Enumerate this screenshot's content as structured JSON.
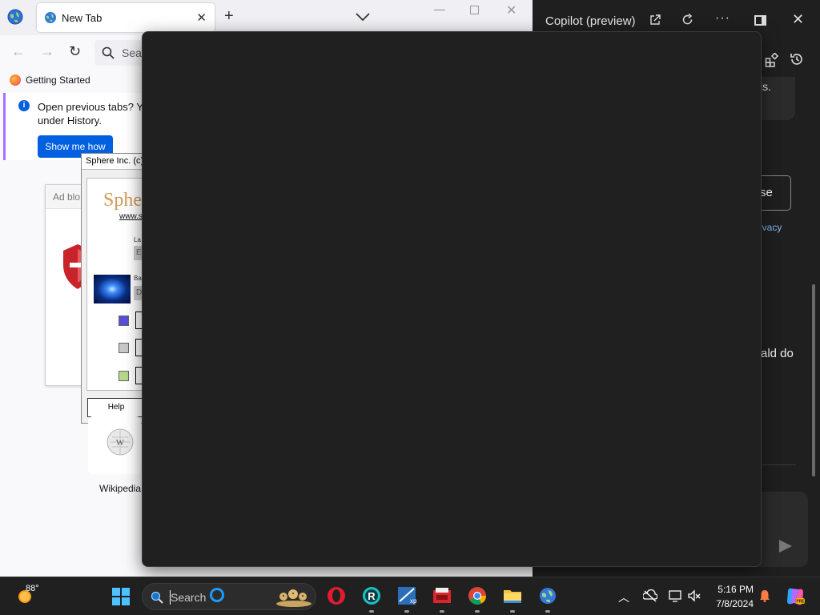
{
  "browser": {
    "tab_title": "New Tab",
    "search_placeholder": "Sea",
    "bookmark": "Getting Started",
    "notice": {
      "line1": "Open previous tabs? You",
      "line2": "under History.",
      "button": "Show me how"
    },
    "adblock_header": "Ad blo",
    "tile_label": "Wikipedia"
  },
  "sphere_window": {
    "title": "Sphere Inc. (c)",
    "logo": "Sphe",
    "url": "www.s",
    "label1": "La",
    "field1": "E",
    "label2": "Ba",
    "field2": "D",
    "swatches": [
      "#5a4fd8",
      "#c8c8c8",
      "#b5d98a"
    ],
    "help_button": "Help"
  },
  "copilot": {
    "title": "Copilot (preview)",
    "card_text": "is.",
    "button_text": "se",
    "privacy_link": "rivacy",
    "body_text": "ald do"
  },
  "taskbar": {
    "temperature": "88°",
    "search_text": "Search",
    "time": "5:16 PM",
    "date": "7/8/2024"
  },
  "colors": {
    "accent_blue": "#0060df",
    "notice_border": "#a374ff",
    "copilot_bg": "#1f1f1f",
    "overlay_bg": "#202020",
    "taskbar_bg": "#202020",
    "windows_blue": "#4cc2ff"
  },
  "icons": {
    "tab_bar": [
      "firefox-globe-icon",
      "globe-icon",
      "close-icon",
      "plus-icon",
      "chevron-down-icon",
      "minimize-icon",
      "maximize-icon",
      "close-icon"
    ],
    "navbar": [
      "back-arrow-icon",
      "forward-arrow-icon",
      "reload-icon",
      "search-icon"
    ],
    "copilot": [
      "external-link-icon",
      "refresh-icon",
      "more-icon",
      "dock-icon",
      "close-icon",
      "apps-icon",
      "history-icon",
      "microphone-icon",
      "send-icon"
    ],
    "taskbar": [
      "weather-icon",
      "windows-start-icon",
      "search-icon",
      "cortana-icon",
      "opera-icon",
      "app-r-icon",
      "xp-app-icon",
      "red-app-icon",
      "chrome-icon",
      "file-explorer-icon",
      "globe-icon",
      "chevron-up-icon",
      "network-icon",
      "display-icon",
      "volume-muted-icon",
      "bell-icon",
      "copilot-icon"
    ]
  }
}
